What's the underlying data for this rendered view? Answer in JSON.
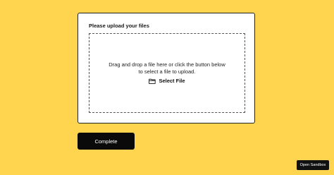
{
  "upload_card": {
    "title": "Please upload your files",
    "dropzone": {
      "instruction": "Drag and drop a file here or click the button below to select a file to upload.",
      "select_label": "Select File",
      "select_icon": "folder-icon"
    }
  },
  "actions": {
    "complete_label": "Complete"
  },
  "sandbox": {
    "open_label": "Open Sandbox"
  },
  "colors": {
    "background": "#FFD54F",
    "card": "#FFFFFF",
    "button": "#0A0A0A"
  }
}
